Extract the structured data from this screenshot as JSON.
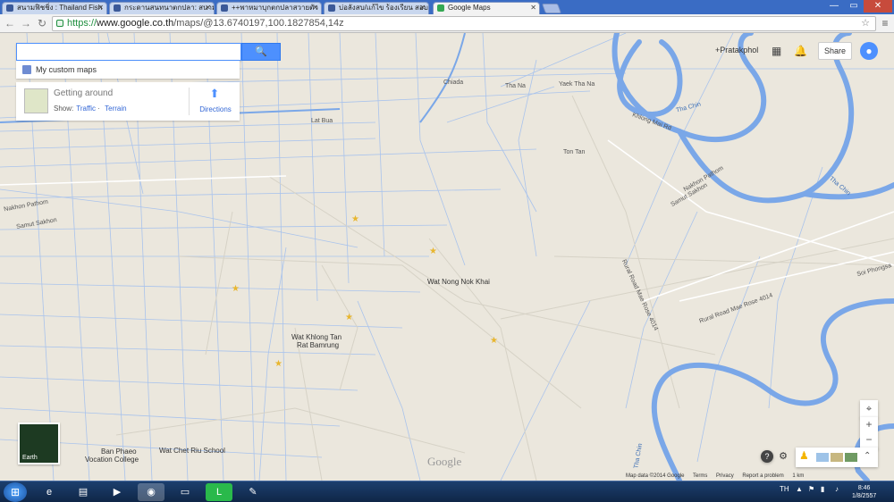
{
  "browser": {
    "tabs": [
      {
        "label": "สนามฟิชชิ่ง : Thailand Fish"
      },
      {
        "label": "กระดานสนทนาตกปลา: สนาม"
      },
      {
        "label": "++พาหมาบุกตกปลาสวายตัว"
      },
      {
        "label": "บ่อลังสบ/แก้ไข ร้องเรียน สอบ"
      },
      {
        "label": "Google Maps"
      }
    ],
    "url_scheme": "https://",
    "url_host": "www.google.co.th",
    "url_path": "/maps/@13.6740197,100.1827854,14z"
  },
  "maps": {
    "search_button": "🔍",
    "custom_maps": "My custom maps",
    "getting_around": "Getting around",
    "show_label": "Show:",
    "traffic": "Traffic",
    "terrain": "Terrain",
    "directions": "Directions",
    "account_name": "+Pratakphol",
    "share": "Share",
    "earth": "Earth",
    "google_logo": "Google",
    "labels": [
      {
        "text": "Lat Bua",
        "cls": ""
      },
      {
        "text": "Chiada",
        "cls": ""
      },
      {
        "text": "Tha Na",
        "cls": ""
      },
      {
        "text": "Yaek Tha Na",
        "cls": ""
      },
      {
        "text": "Khlong Mai Rd",
        "cls": ""
      },
      {
        "text": "Ton Tan",
        "cls": ""
      },
      {
        "text": "Tha Chin",
        "cls": "river"
      },
      {
        "text": "Tha Chin",
        "cls": "river"
      },
      {
        "text": "Nakhon Pathom",
        "cls": ""
      },
      {
        "text": "Samut Sakhon",
        "cls": ""
      },
      {
        "text": "Wat Nong Nok Khai",
        "cls": "big"
      },
      {
        "text": "Wat Khlong Tan",
        "cls": "big"
      },
      {
        "text": "Rat Bamrung",
        "cls": "big"
      },
      {
        "text": "Ban Phaeo",
        "cls": "big"
      },
      {
        "text": "Vocation College",
        "cls": "big"
      },
      {
        "text": "Wat Chet Riu School",
        "cls": "big"
      },
      {
        "text": "Rural Road Mae Rose 4014",
        "cls": ""
      },
      {
        "text": "Rural Road Mae Rose 4014",
        "cls": ""
      },
      {
        "text": "Nakhon Pathom",
        "cls": ""
      },
      {
        "text": "Samut Sakhon",
        "cls": ""
      },
      {
        "text": "Soi Phongsa",
        "cls": ""
      },
      {
        "text": "Tha Chin",
        "cls": "river"
      }
    ],
    "footer": [
      "Map data ©2014 Google",
      "Terms",
      "Privacy",
      "Report a problem",
      "1 km"
    ]
  },
  "taskbar": {
    "lang": "TH",
    "time": "8:46",
    "date": "1/8/2557"
  }
}
